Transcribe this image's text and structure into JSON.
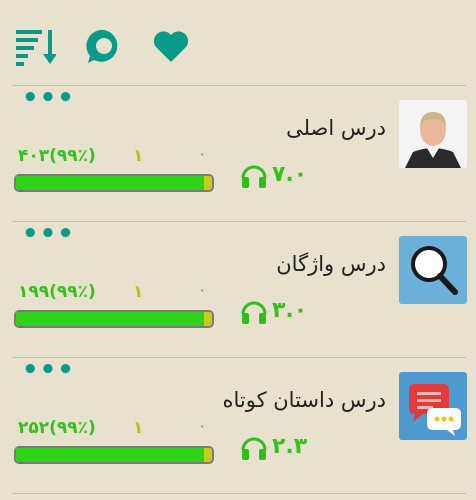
{
  "toolbar": {
    "icons": [
      "sort-icon",
      "chat-icon",
      "heart-icon"
    ],
    "accent_color": "#0a9a8a"
  },
  "lessons": [
    {
      "title": "درس اصلی",
      "count_label": "۴۰۳(۹۹٪)",
      "mid_label": "۱",
      "zero_label": "۰",
      "duration": "۷.۰",
      "progress": 0.99,
      "thumb": "portrait"
    },
    {
      "title": "درس واژگان",
      "count_label": "۱۹۹(۹۹٪)",
      "mid_label": "۱",
      "zero_label": "۰",
      "duration": "۳.۰",
      "progress": 0.99,
      "thumb": "magnifier-icon"
    },
    {
      "title": "درس داستان کوتاه",
      "count_label": "۲۵۲(۹۹٪)",
      "mid_label": "۱",
      "zero_label": "۰",
      "duration": "۲.۳",
      "progress": 0.99,
      "thumb": "chat-bubbles-icon"
    }
  ],
  "colors": {
    "background": "#e8e1cd",
    "progress_green": "#2fd41a",
    "progress_yellow": "#c9c91a"
  }
}
